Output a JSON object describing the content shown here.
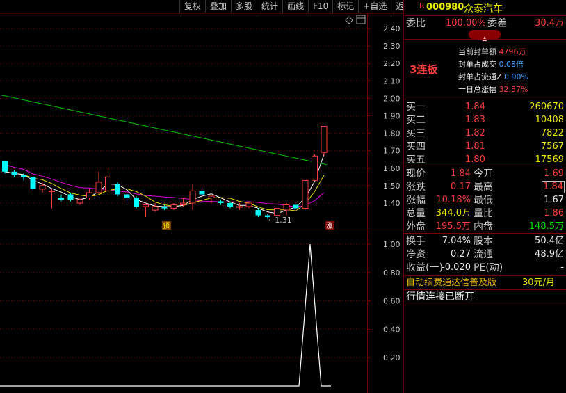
{
  "toolbar": {
    "buttons": [
      "复权",
      "叠加",
      "多股",
      "统计",
      "画线",
      "F10",
      "标记",
      "+自选",
      "返回"
    ]
  },
  "chart": {
    "y_ticks_top": [
      "2.40",
      "2.30",
      "2.20",
      "2.10",
      "2.00",
      "1.90",
      "1.80",
      "1.70",
      "1.60",
      "1.50",
      "1.40"
    ],
    "y_ticks_bottom": [
      "1.00",
      "0.80",
      "0.60",
      "0.40",
      "0.20"
    ],
    "low_marker": "←1.31",
    "tag_yu": "预",
    "tag_zhang": "涨",
    "colors": {
      "up": "#ff3c3c",
      "down": "#00ffff",
      "ma_green": "#00c000",
      "ma_magenta": "#e000e0",
      "ma_yellow": "#e0e000",
      "ma_white": "#ffffff"
    }
  },
  "chart_data": {
    "type": "candlestick",
    "candles": [
      {
        "o": 1.64,
        "c": 1.58,
        "h": 1.64,
        "l": 1.57
      },
      {
        "o": 1.58,
        "c": 1.56,
        "h": 1.59,
        "l": 1.55
      },
      {
        "o": 1.56,
        "c": 1.55,
        "h": 1.57,
        "l": 1.53
      },
      {
        "o": 1.55,
        "c": 1.48,
        "h": 1.55,
        "l": 1.47
      },
      {
        "o": 1.48,
        "c": 1.5,
        "h": 1.52,
        "l": 1.46
      },
      {
        "o": 1.47,
        "c": 1.47,
        "h": 1.48,
        "l": 1.37
      },
      {
        "o": 1.43,
        "c": 1.42,
        "h": 1.45,
        "l": 1.41
      },
      {
        "o": 1.45,
        "c": 1.42,
        "h": 1.46,
        "l": 1.41
      },
      {
        "o": 1.4,
        "c": 1.42,
        "h": 1.43,
        "l": 1.39
      },
      {
        "o": 1.43,
        "c": 1.46,
        "h": 1.48,
        "l": 1.42
      },
      {
        "o": 1.46,
        "c": 1.52,
        "h": 1.58,
        "l": 1.45
      },
      {
        "o": 1.47,
        "c": 1.55,
        "h": 1.6,
        "l": 1.46
      },
      {
        "o": 1.51,
        "c": 1.45,
        "h": 1.52,
        "l": 1.44
      },
      {
        "o": 1.45,
        "c": 1.43,
        "h": 1.46,
        "l": 1.4
      },
      {
        "o": 1.43,
        "c": 1.38,
        "h": 1.44,
        "l": 1.37
      },
      {
        "o": 1.38,
        "c": 1.39,
        "h": 1.4,
        "l": 1.32
      },
      {
        "o": 1.36,
        "c": 1.38,
        "h": 1.4,
        "l": 1.35
      },
      {
        "o": 1.38,
        "c": 1.37,
        "h": 1.39,
        "l": 1.36
      },
      {
        "o": 1.37,
        "c": 1.39,
        "h": 1.4,
        "l": 1.36
      },
      {
        "o": 1.39,
        "c": 1.4,
        "h": 1.43,
        "l": 1.38
      },
      {
        "o": 1.4,
        "c": 1.47,
        "h": 1.51,
        "l": 1.36
      },
      {
        "o": 1.47,
        "c": 1.45,
        "h": 1.49,
        "l": 1.44
      },
      {
        "o": 1.43,
        "c": 1.44,
        "h": 1.45,
        "l": 1.4
      },
      {
        "o": 1.41,
        "c": 1.4,
        "h": 1.42,
        "l": 1.39
      },
      {
        "o": 1.4,
        "c": 1.38,
        "h": 1.41,
        "l": 1.37
      },
      {
        "o": 1.38,
        "c": 1.38,
        "h": 1.4,
        "l": 1.36
      },
      {
        "o": 1.38,
        "c": 1.4,
        "h": 1.41,
        "l": 1.37
      },
      {
        "o": 1.36,
        "c": 1.33,
        "h": 1.37,
        "l": 1.32
      },
      {
        "o": 1.33,
        "c": 1.32,
        "h": 1.34,
        "l": 1.31
      },
      {
        "o": 1.33,
        "c": 1.37,
        "h": 1.38,
        "l": 1.32
      },
      {
        "o": 1.36,
        "c": 1.39,
        "h": 1.4,
        "l": 1.33
      },
      {
        "o": 1.39,
        "c": 1.37,
        "h": 1.41,
        "l": 1.36
      },
      {
        "o": 1.37,
        "c": 1.53,
        "h": 1.53,
        "l": 1.37
      },
      {
        "o": 1.53,
        "c": 1.67,
        "h": 1.68,
        "l": 1.53
      },
      {
        "o": 1.69,
        "c": 1.84,
        "h": 1.84,
        "l": 1.67
      }
    ],
    "ma_green": [
      2.02,
      1.78,
      1.62
    ],
    "indicator": {
      "spike_value": 1.0,
      "baseline": 0.0
    },
    "ylim_price": [
      1.3,
      2.45
    ],
    "ylim_indicator": [
      0,
      1.1
    ]
  },
  "quote": {
    "marker": "R",
    "code": "000980",
    "name": "众泰汽车",
    "weibi_label": "委比",
    "weibi_value": "100.00%",
    "weicha_label": "委差",
    "weicha_value": "30.4万",
    "lianban": "3连板",
    "seal_rows": [
      {
        "label": "当前封单额",
        "value": "4796万"
      },
      {
        "label": "封单占成交",
        "value": "0.08倍"
      },
      {
        "label": "封单占流通Z",
        "value": "0.90%"
      },
      {
        "label": "十日总涨幅",
        "value": "32.37%"
      }
    ],
    "bids": [
      {
        "label": "买一",
        "price": "1.84",
        "vol": "260670"
      },
      {
        "label": "买二",
        "price": "1.83",
        "vol": "10408"
      },
      {
        "label": "买三",
        "price": "1.82",
        "vol": "7822"
      },
      {
        "label": "买四",
        "price": "1.81",
        "vol": "7567"
      },
      {
        "label": "买五",
        "price": "1.80",
        "vol": "17569"
      }
    ],
    "stats": [
      {
        "l1": "现价",
        "v1": "1.84",
        "l2": "今开",
        "v2": "1.69"
      },
      {
        "l1": "涨跌",
        "v1": "0.17",
        "l2": "最高",
        "v2": "1.84"
      },
      {
        "l1": "涨幅",
        "v1": "10.18%",
        "l2": "最低",
        "v2": "1.67"
      },
      {
        "l1": "总量",
        "v1": "344.0万",
        "l2": "量比",
        "v2": "1.86"
      },
      {
        "l1": "外盘",
        "v1": "195.5万",
        "l2": "内盘",
        "v2": "148.5万"
      }
    ],
    "stats2": [
      {
        "l1": "换手",
        "v1": "7.04%",
        "l2": "股本",
        "v2": "50.4亿"
      },
      {
        "l1": "净资",
        "v1": "0.27",
        "l2": "流通",
        "v2": "48.9亿"
      },
      {
        "l1": "收益(一)",
        "v1": "-0.020",
        "l2": "PE(动)",
        "v2": "-"
      }
    ],
    "promo": "自动续费通达信普及版",
    "promo_price": "30元/月",
    "status": "行情连接已断开"
  }
}
